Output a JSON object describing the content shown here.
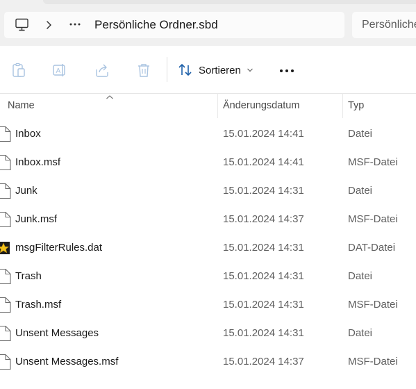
{
  "address_bar": {
    "path_label": "Persönliche Ordner.sbd",
    "search_placeholder": "Persönliche Ordner.sbd durchsuchen"
  },
  "toolbar": {
    "sort_label": "Sortieren"
  },
  "columns": {
    "name": "Name",
    "date": "Änderungsdatum",
    "type": "Typ"
  },
  "files": [
    {
      "name": "Inbox",
      "date": "15.01.2024 14:41",
      "type": "Datei",
      "icon": "blank-file-icon"
    },
    {
      "name": "Inbox.msf",
      "date": "15.01.2024 14:41",
      "type": "MSF-Datei",
      "icon": "blank-file-icon"
    },
    {
      "name": "Junk",
      "date": "15.01.2024 14:31",
      "type": "Datei",
      "icon": "blank-file-icon"
    },
    {
      "name": "Junk.msf",
      "date": "15.01.2024 14:37",
      "type": "MSF-Datei",
      "icon": "blank-file-icon"
    },
    {
      "name": "msgFilterRules.dat",
      "date": "15.01.2024 14:31",
      "type": "DAT-Datei",
      "icon": "star-file-icon"
    },
    {
      "name": "Trash",
      "date": "15.01.2024 14:31",
      "type": "Datei",
      "icon": "blank-file-icon"
    },
    {
      "name": "Trash.msf",
      "date": "15.01.2024 14:31",
      "type": "MSF-Datei",
      "icon": "blank-file-icon"
    },
    {
      "name": "Unsent Messages",
      "date": "15.01.2024 14:31",
      "type": "Datei",
      "icon": "blank-file-icon"
    },
    {
      "name": "Unsent Messages.msf",
      "date": "15.01.2024 14:37",
      "type": "MSF-Datei",
      "icon": "blank-file-icon"
    }
  ]
}
